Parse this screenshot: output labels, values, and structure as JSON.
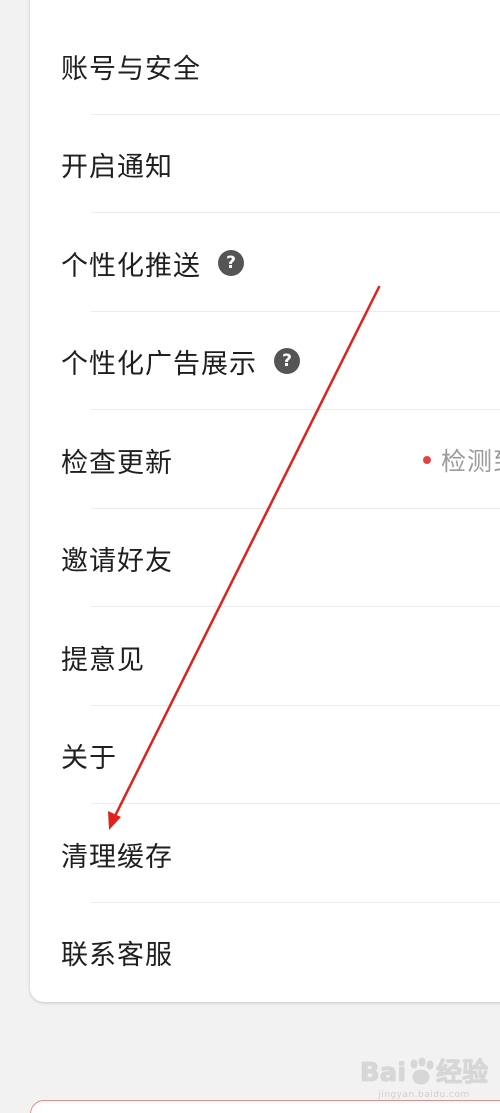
{
  "settings": {
    "items": [
      {
        "label": "账号与安全"
      },
      {
        "label": "开启通知"
      },
      {
        "label": "个性化推送"
      },
      {
        "label": "个性化广告展示"
      },
      {
        "label": "检查更新",
        "status": "检测到新"
      },
      {
        "label": "邀请好友"
      },
      {
        "label": "提意见"
      },
      {
        "label": "关于"
      },
      {
        "label": "清理缓存"
      },
      {
        "label": "联系客服"
      }
    ],
    "help_glyph": "?"
  },
  "annotation": {
    "color": "#e0211c"
  },
  "watermark": {
    "brand_left": "Bai",
    "brand_right": "经验",
    "url": "jingyan.baidu.com"
  }
}
